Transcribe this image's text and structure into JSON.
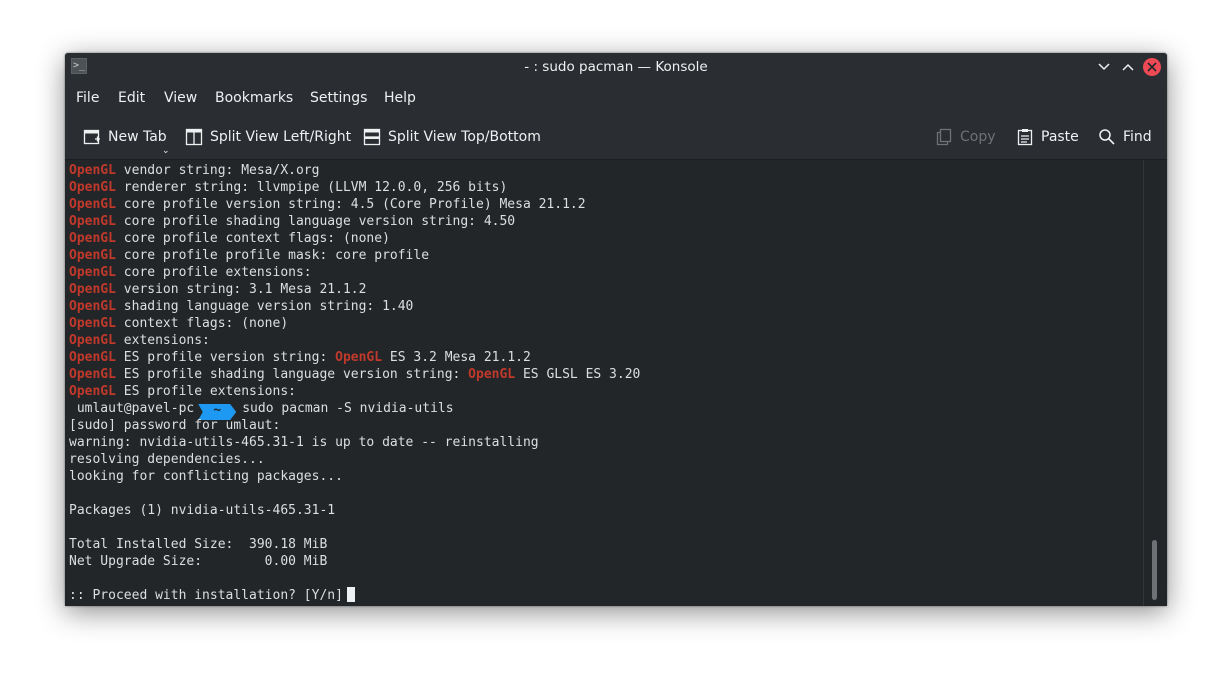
{
  "window": {
    "title": "- : sudo pacman — Konsole",
    "app_icon_glyph": ">_"
  },
  "menu": {
    "items": [
      "File",
      "Edit",
      "View",
      "Bookmarks",
      "Settings",
      "Help"
    ]
  },
  "toolbar": {
    "new_tab": "New Tab",
    "split_left_right": "Split View Left/Right",
    "split_top_bottom": "Split View Top/Bottom",
    "copy": "Copy",
    "paste": "Paste",
    "find": "Find"
  },
  "terminal": {
    "highlight_word": "OpenGL",
    "highlight_color": "#c0392b",
    "lines": [
      {
        "prefix": "OpenGL",
        "text": " vendor string: Mesa/X.org"
      },
      {
        "prefix": "OpenGL",
        "text": " renderer string: llvmpipe (LLVM 12.0.0, 256 bits)"
      },
      {
        "prefix": "OpenGL",
        "text": " core profile version string: 4.5 (Core Profile) Mesa 21.1.2"
      },
      {
        "prefix": "OpenGL",
        "text": " core profile shading language version string: 4.50"
      },
      {
        "prefix": "OpenGL",
        "text": " core profile context flags: (none)"
      },
      {
        "prefix": "OpenGL",
        "text": " core profile profile mask: core profile"
      },
      {
        "prefix": "OpenGL",
        "text": " core profile extensions:"
      },
      {
        "prefix": "OpenGL",
        "text": " version string: 3.1 Mesa 21.1.2"
      },
      {
        "prefix": "OpenGL",
        "text": " shading language version string: 1.40"
      },
      {
        "prefix": "OpenGL",
        "text": " context flags: (none)"
      },
      {
        "prefix": "OpenGL",
        "text": " extensions:"
      },
      {
        "prefix": "OpenGL",
        "text": " ES profile version string: ",
        "mid": "OpenGL",
        "tail": " ES 3.2 Mesa 21.1.2"
      },
      {
        "prefix": "OpenGL",
        "text": " ES profile shading language version string: ",
        "mid": "OpenGL",
        "tail": " ES GLSL ES 3.20"
      },
      {
        "prefix": "OpenGL",
        "text": " ES profile extensions:"
      }
    ],
    "prompt": {
      "user_host": " umlaut@pavel-pc",
      "dir": "~",
      "command": "sudo pacman -S nvidia-utils"
    },
    "output": [
      "[sudo] password for umlaut:",
      "warning: nvidia-utils-465.31-1 is up to date -- reinstalling",
      "resolving dependencies...",
      "looking for conflicting packages...",
      "",
      "Packages (1) nvidia-utils-465.31-1",
      "",
      "Total Installed Size:  390.18 MiB",
      "Net Upgrade Size:        0.00 MiB",
      "",
      ":: Proceed with installation? [Y/n]"
    ]
  },
  "colors": {
    "accent": "#1d99f3",
    "close_button": "#ed4a55",
    "background": "#232629"
  }
}
